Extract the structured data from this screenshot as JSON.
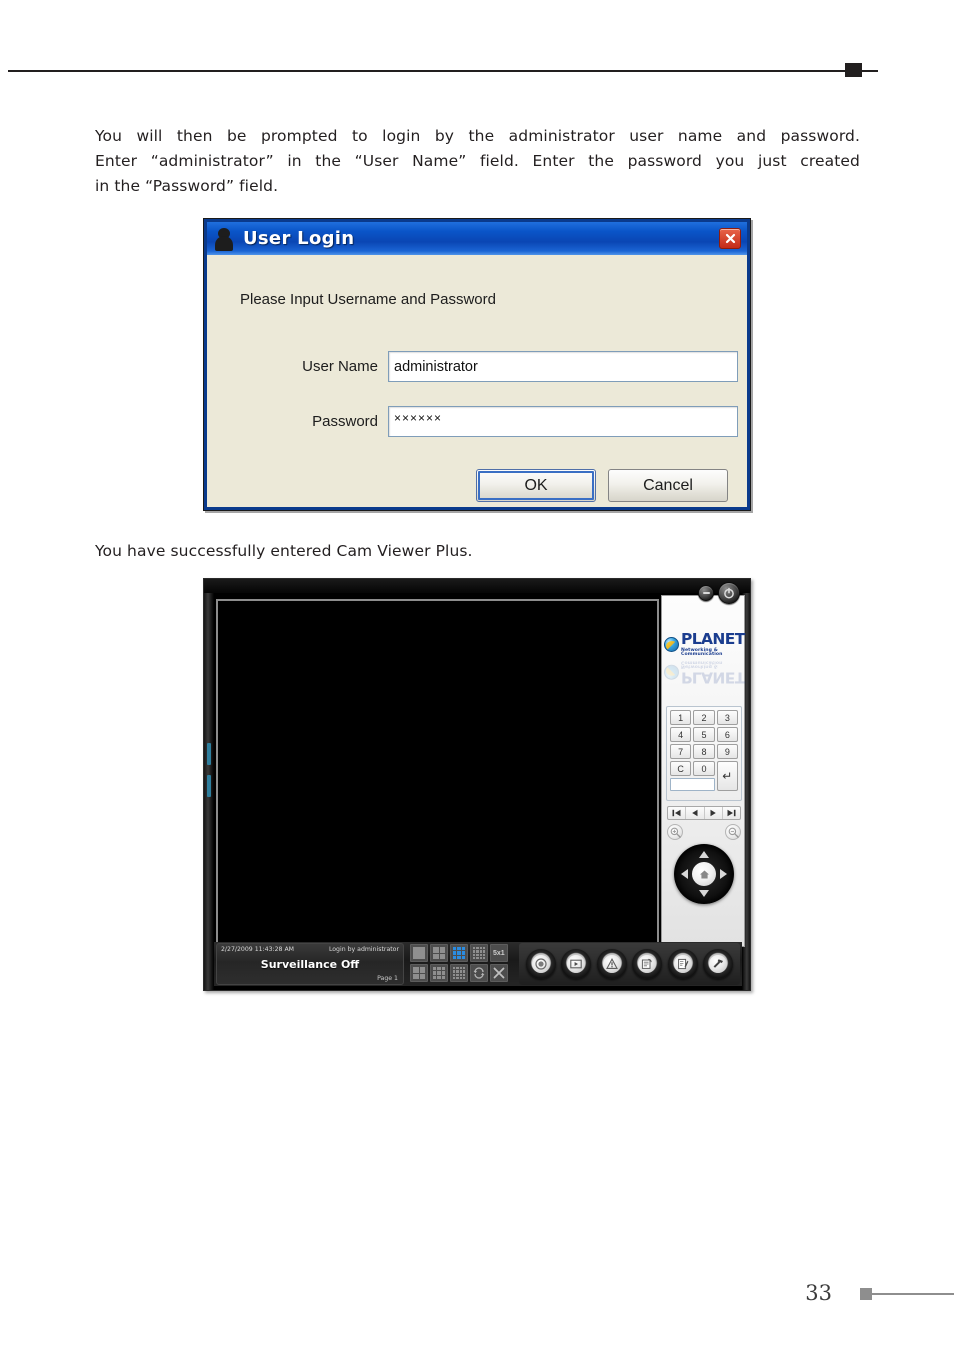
{
  "document": {
    "page_number": "33",
    "paragraph_1_lines": [
      "You will then be prompted to login by the administrator user name and password.",
      "Enter “administrator” in the “User Name” field. Enter the password you just created",
      "in the “Password” field."
    ],
    "paragraph_2": "You have successfully entered Cam Viewer Plus."
  },
  "login_dialog": {
    "title": "User Login",
    "title_icon": "person-icon",
    "close_icon": "close-icon",
    "prompt": "Please Input Username and Password",
    "fields": [
      {
        "label": "User Name",
        "value": "administrator",
        "placeholder": ""
      },
      {
        "label": "Password",
        "value": "××××××",
        "placeholder": ""
      }
    ],
    "buttons": [
      {
        "label": "OK",
        "default": true
      },
      {
        "label": "Cancel",
        "default": false
      }
    ],
    "colors": {
      "titlebar": "#0a55c8",
      "body": "#ece9d8",
      "close": "#c42a18"
    }
  },
  "cam_viewer": {
    "window_controls": [
      {
        "name": "minimize-button",
        "icon": "minus-icon"
      },
      {
        "name": "power-button",
        "icon": "power-icon"
      }
    ],
    "brand": {
      "name": "PLANET",
      "tagline": "Networking & Communication",
      "icon": "globe-icon"
    },
    "keypad": {
      "keys": [
        "1",
        "2",
        "3",
        "4",
        "5",
        "6",
        "7",
        "8",
        "9",
        "C",
        "0"
      ],
      "enter_key": "↵",
      "display_value": ""
    },
    "transport_buttons": [
      {
        "name": "first-button",
        "icon": "skip-back-icon"
      },
      {
        "name": "previous-button",
        "icon": "rewind-icon"
      },
      {
        "name": "next-button",
        "icon": "forward-icon"
      },
      {
        "name": "last-button",
        "icon": "skip-forward-icon"
      }
    ],
    "zoom_buttons": [
      {
        "name": "zoom-in-button",
        "icon": "magnifier-plus-icon"
      },
      {
        "name": "zoom-out-button",
        "icon": "magnifier-minus-icon"
      }
    ],
    "ptz": {
      "name": "ptz-joystick",
      "center_icon": "home-icon",
      "directions": [
        "up",
        "down",
        "left",
        "right"
      ]
    },
    "status": {
      "timestamp": "2/27/2009 11:43:28 AM",
      "login_text": "Login by administrator",
      "surveillance_state": "Surveillance Off",
      "page_label": "Page 1"
    },
    "layout_buttons": [
      {
        "name": "layout-1x1",
        "grid": 1,
        "active": false,
        "label": ""
      },
      {
        "name": "layout-2x2",
        "grid": 2,
        "active": false,
        "label": ""
      },
      {
        "name": "layout-3x3",
        "grid": 3,
        "active": true,
        "label": ""
      },
      {
        "name": "layout-4x4",
        "grid": 4,
        "active": false,
        "label": ""
      },
      {
        "name": "layout-5plus",
        "grid": 0,
        "active": false,
        "label": "5x1"
      },
      {
        "name": "layout-mixed-a",
        "grid": 2,
        "active": false,
        "label": ""
      },
      {
        "name": "layout-mixed-b",
        "grid": 3,
        "active": false,
        "label": ""
      },
      {
        "name": "layout-mixed-c",
        "grid": 4,
        "active": false,
        "label": ""
      },
      {
        "name": "layout-rotate",
        "grid": 0,
        "active": false,
        "label": ""
      },
      {
        "name": "layout-close",
        "grid": 0,
        "active": false,
        "label": ""
      }
    ],
    "toolbar_buttons": [
      {
        "name": "record-button",
        "icon": "record-icon"
      },
      {
        "name": "playback-button",
        "icon": "play-icon"
      },
      {
        "name": "alarm-button",
        "icon": "warning-icon"
      },
      {
        "name": "log-button",
        "icon": "report-icon"
      },
      {
        "name": "config-button",
        "icon": "edit-icon"
      },
      {
        "name": "setup-button",
        "icon": "hammer-icon"
      }
    ]
  }
}
